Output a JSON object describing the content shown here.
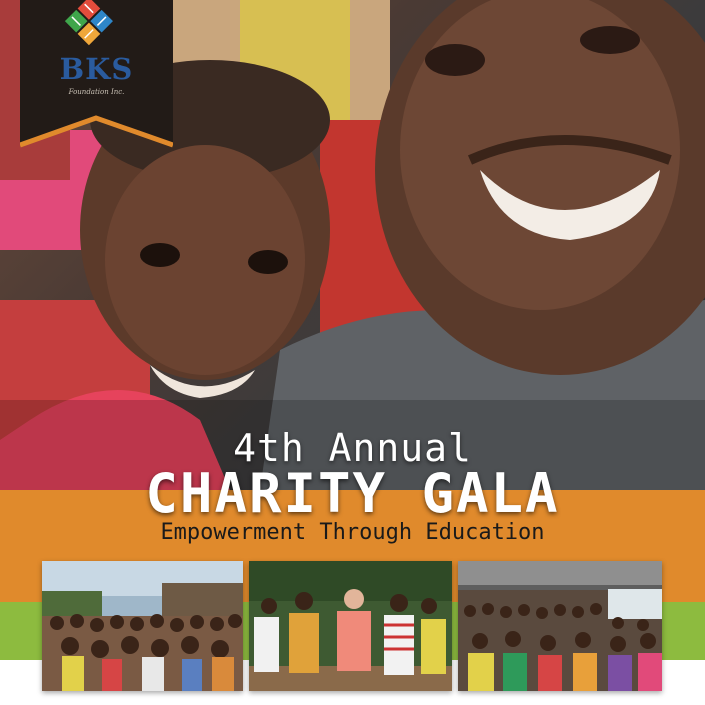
{
  "logo": {
    "name": "BKS",
    "subtitle": "Foundation Inc.",
    "icon": "bks-squares-logo-icon",
    "colors": [
      "#e24c3c",
      "#2e86c8",
      "#3fa64b",
      "#f0a73a"
    ]
  },
  "headline": {
    "line1": "4th Annual",
    "line2": "CHARITY GALA",
    "tagline": "Empowerment Through Education"
  },
  "colors": {
    "orange_band": "#e08a2c",
    "green_band": "#8dbb3f",
    "logo_banner": "#221b17",
    "logo_accent": "#e08a2c"
  },
  "photos": [
    {
      "icon": "crowd-of-children-photo-icon"
    },
    {
      "icon": "group-standing-outdoors-photo-icon"
    },
    {
      "icon": "crowd-under-shelter-photo-icon"
    }
  ]
}
